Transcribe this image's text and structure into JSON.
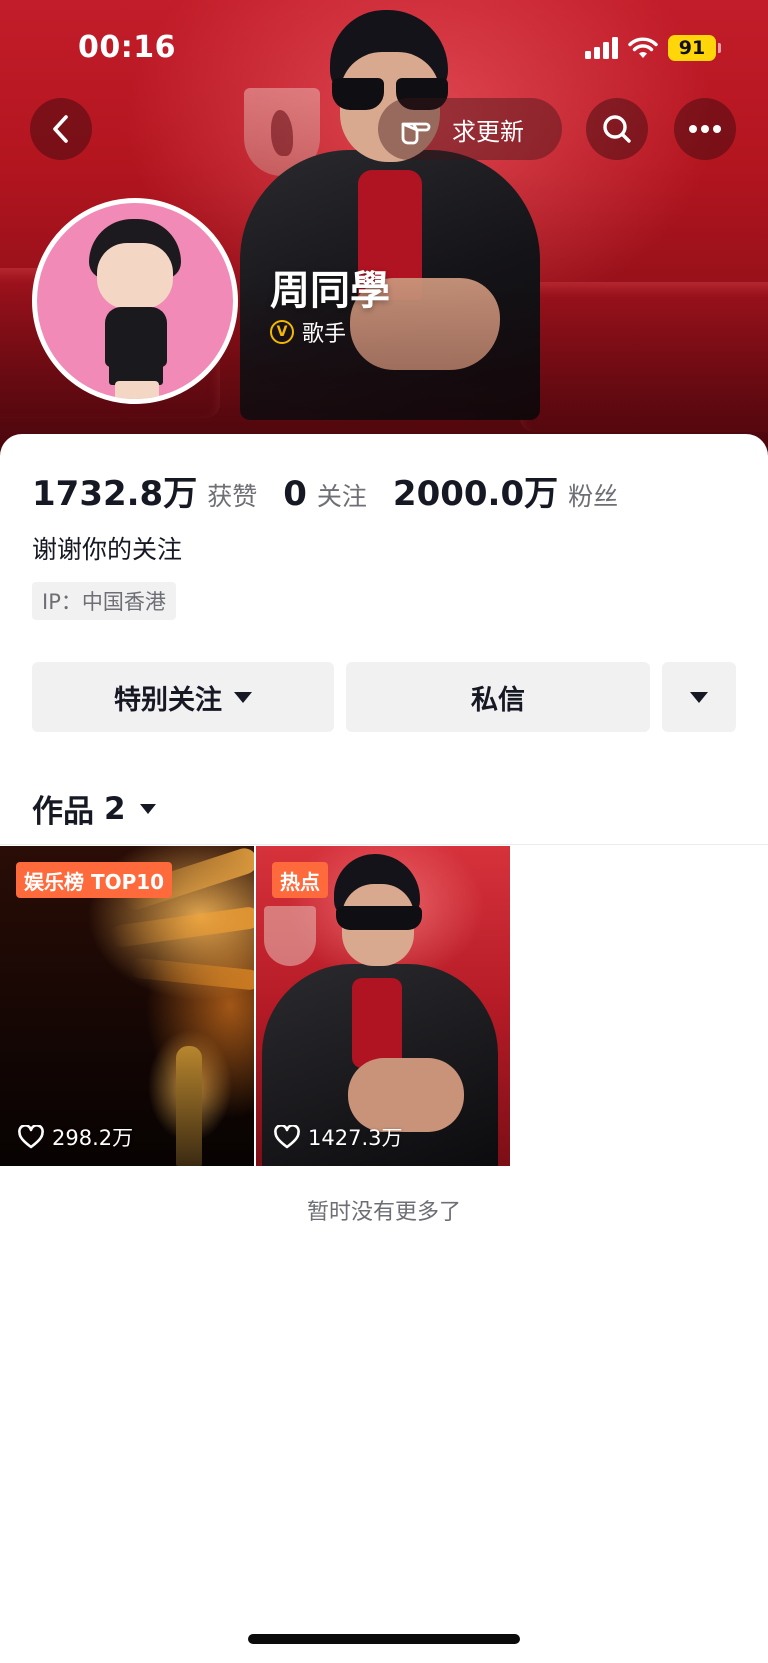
{
  "status_bar": {
    "time": "00:16",
    "battery": "91",
    "icons": [
      "cellular-signal-icon",
      "wifi-icon",
      "battery-icon"
    ]
  },
  "nav": {
    "back_icon": "chevron-left-icon",
    "request_update_label": "求更新",
    "request_update_icon": "pointing-hand-icon",
    "search_icon": "search-icon",
    "more_icon": "more-dots-icon"
  },
  "profile": {
    "name": "周同學",
    "verification_label": "歌手",
    "verification_icon": "verified-v-icon",
    "bio": "谢谢你的关注",
    "ip_tag": "IP：中国香港"
  },
  "stats": [
    {
      "value": "1732.8万",
      "label": "获赞"
    },
    {
      "value": "0",
      "label": "关注"
    },
    {
      "value": "2000.0万",
      "label": "粉丝"
    }
  ],
  "actions": {
    "special_follow": "特别关注",
    "message": "私信"
  },
  "works": {
    "label": "作品",
    "count": "2",
    "items": [
      {
        "badge": "娱乐榜 TOP10",
        "likes": "298.2万"
      },
      {
        "badge": "热点",
        "likes": "1427.3万"
      }
    ],
    "no_more": "暂时没有更多了"
  },
  "colors": {
    "badge": "#ff6a3d",
    "verified": "#f5b800",
    "battery": "#ffd60a",
    "button_bg": "#f1f1f2"
  }
}
